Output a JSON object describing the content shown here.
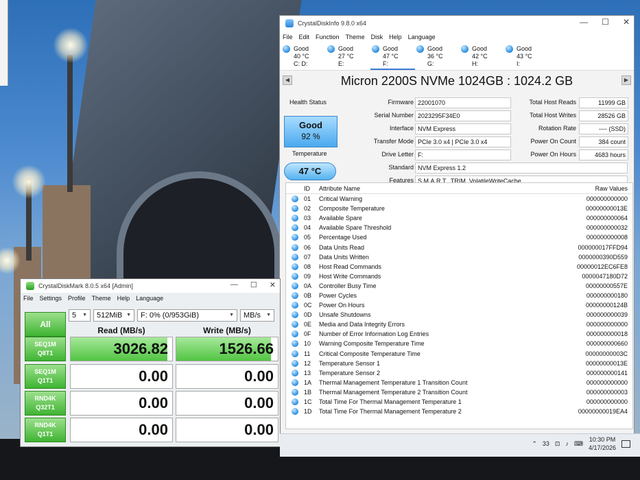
{
  "cdi": {
    "title": "CrystalDiskInfo 9.8.0 x64",
    "menu": [
      "File",
      "Edit",
      "Function",
      "Theme",
      "Disk",
      "Help",
      "Language"
    ],
    "drives": [
      {
        "status": "Good",
        "temp": "40 °C",
        "letter": "C: D:"
      },
      {
        "status": "Good",
        "temp": "27 °C",
        "letter": "E:"
      },
      {
        "status": "Good",
        "temp": "47 °C",
        "letter": "F:"
      },
      {
        "status": "Good",
        "temp": "36 °C",
        "letter": "G:"
      },
      {
        "status": "Good",
        "temp": "42 °C",
        "letter": "H:"
      },
      {
        "status": "Good",
        "temp": "43 °C",
        "letter": "I:"
      }
    ],
    "model": "Micron 2200S NVMe 1024GB : 1024.2 GB",
    "health_label": "Health Status",
    "health_status": "Good",
    "health_percent": "92 %",
    "temp_label": "Temperature",
    "temp_value": "47 °C",
    "labels": {
      "firmware": "Firmware",
      "serial": "Serial Number",
      "interface": "Interface",
      "transfer": "Transfer Mode",
      "letter": "Drive Letter",
      "standard": "Standard",
      "features": "Features",
      "reads": "Total Host Reads",
      "writes": "Total Host Writes",
      "rotation": "Rotation Rate",
      "power_count": "Power On Count",
      "power_hours": "Power On Hours"
    },
    "values": {
      "firmware": "22001070",
      "serial": "2023295F34E0",
      "interface": "NVM Express",
      "transfer": "PCIe 3.0 x4 | PCIe 3.0 x4",
      "letter": "F:",
      "standard": "NVM Express 1.2",
      "features": "S.M.A.R.T., TRIM, VolatileWriteCache",
      "reads": "11999 GB",
      "writes": "28526 GB",
      "rotation": "---- (SSD)",
      "power_count": "384 count",
      "power_hours": "4683 hours"
    },
    "smart_headers": {
      "id": "ID",
      "name": "Attribute Name",
      "raw": "Raw Values"
    },
    "smart": [
      {
        "id": "01",
        "name": "Critical Warning",
        "raw": "000000000000"
      },
      {
        "id": "02",
        "name": "Composite Temperature",
        "raw": "00000000013E"
      },
      {
        "id": "03",
        "name": "Available Spare",
        "raw": "000000000064"
      },
      {
        "id": "04",
        "name": "Available Spare Threshold",
        "raw": "000000000032"
      },
      {
        "id": "05",
        "name": "Percentage Used",
        "raw": "000000000008"
      },
      {
        "id": "06",
        "name": "Data Units Read",
        "raw": "000000017FFD94"
      },
      {
        "id": "07",
        "name": "Data Units Written",
        "raw": "0000000390D559"
      },
      {
        "id": "08",
        "name": "Host Read Commands",
        "raw": "00000012EC6FE8"
      },
      {
        "id": "09",
        "name": "Host Write Commands",
        "raw": "0000047180D72"
      },
      {
        "id": "0A",
        "name": "Controller Busy Time",
        "raw": "00000000557E"
      },
      {
        "id": "0B",
        "name": "Power Cycles",
        "raw": "000000000180"
      },
      {
        "id": "0C",
        "name": "Power On Hours",
        "raw": "00000000124B"
      },
      {
        "id": "0D",
        "name": "Unsafe Shutdowns",
        "raw": "000000000039"
      },
      {
        "id": "0E",
        "name": "Media and Data Integrity Errors",
        "raw": "000000000000"
      },
      {
        "id": "0F",
        "name": "Number of Error Information Log Entries",
        "raw": "000000000018"
      },
      {
        "id": "10",
        "name": "Warning Composite Temperature Time",
        "raw": "000000000660"
      },
      {
        "id": "11",
        "name": "Critical Composite Temperature Time",
        "raw": "00000000003C"
      },
      {
        "id": "12",
        "name": "Temperature Sensor 1",
        "raw": "00000000013E"
      },
      {
        "id": "13",
        "name": "Temperature Sensor 2",
        "raw": "000000000141"
      },
      {
        "id": "1A",
        "name": "Thermal Management Temperature 1 Transition Count",
        "raw": "000000000000"
      },
      {
        "id": "1B",
        "name": "Thermal Management Temperature 2 Transition Count",
        "raw": "000000000003"
      },
      {
        "id": "1C",
        "name": "Total Time For Thermal Management Temperature 1",
        "raw": "000000000000"
      },
      {
        "id": "1D",
        "name": "Total Time For Thermal Management Temperature 2",
        "raw": "00000000019EA4"
      }
    ]
  },
  "cdm": {
    "title": "CrystalDiskMark 8.0.5 x64 [Admin]",
    "menu": [
      "File",
      "Settings",
      "Profile",
      "Theme",
      "Help",
      "Language"
    ],
    "all_label": "All",
    "count": "5",
    "size": "512MiB",
    "drive": "F: 0% (0/953GiB)",
    "unit": "MB/s",
    "read_header": "Read (MB/s)",
    "write_header": "Write (MB/s)",
    "tests": [
      {
        "l1": "SEQ1M",
        "l2": "Q8T1",
        "read": "3026.82",
        "write": "1526.66",
        "read_fill": 0.95,
        "write_fill": 0.93
      },
      {
        "l1": "SEQ1M",
        "l2": "Q1T1",
        "read": "0.00",
        "write": "0.00",
        "read_fill": 0,
        "write_fill": 0
      },
      {
        "l1": "RND4K",
        "l2": "Q32T1",
        "read": "0.00",
        "write": "0.00",
        "read_fill": 0,
        "write_fill": 0
      },
      {
        "l1": "RND4K",
        "l2": "Q1T1",
        "read": "0.00",
        "write": "0.00",
        "read_fill": 0,
        "write_fill": 0
      }
    ]
  },
  "taskbar": {
    "tray_count": "33",
    "time": "10:30 PM",
    "date": "4/17/2026"
  }
}
